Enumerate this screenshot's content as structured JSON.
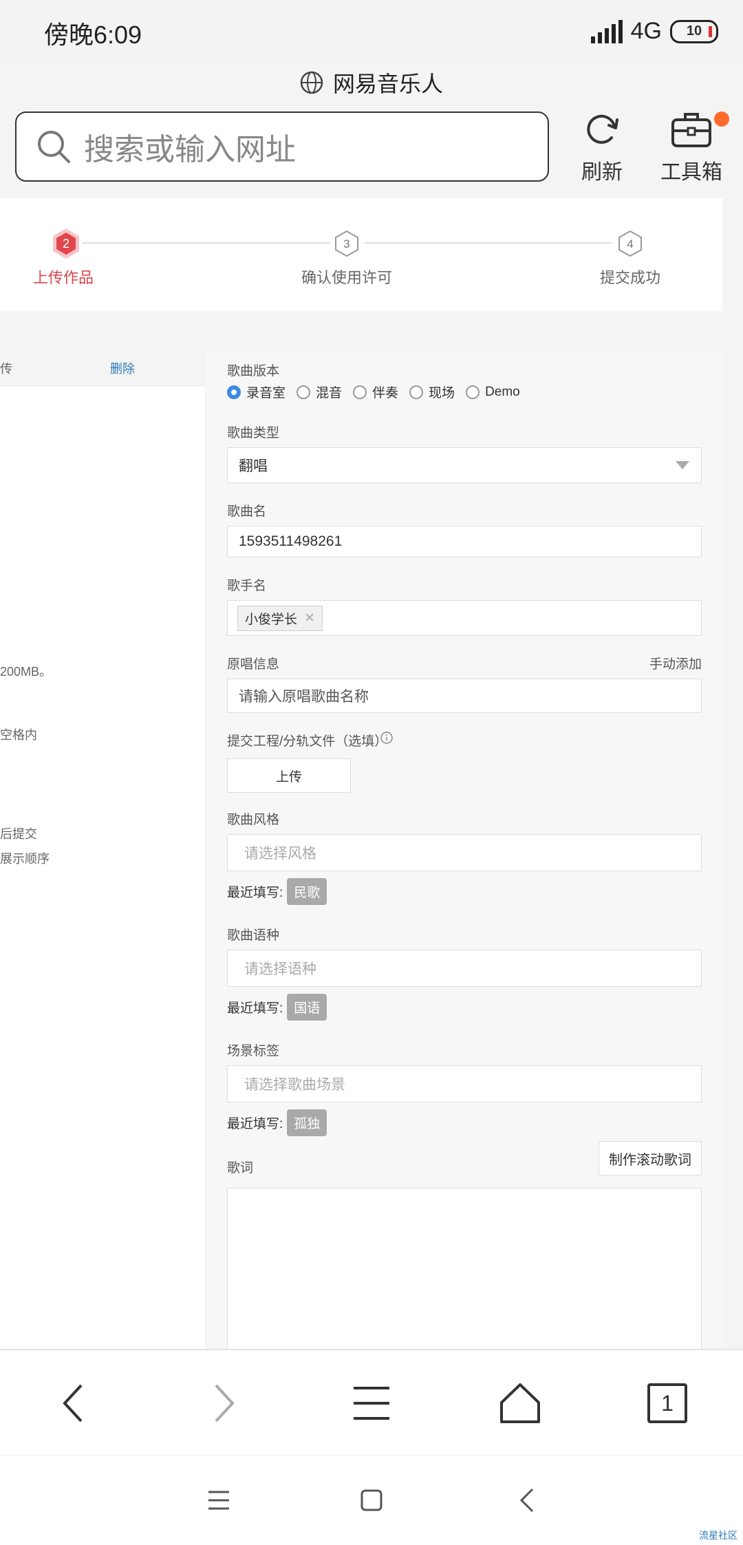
{
  "status_bar": {
    "time": "傍晚6:09",
    "network": "4G",
    "battery": "10"
  },
  "browser": {
    "title": "网易音乐人",
    "search_placeholder": "搜索或输入网址",
    "refresh_label": "刷新",
    "toolbox_label": "工具箱"
  },
  "steps": [
    {
      "number": "2",
      "label": "上传作品",
      "active": true
    },
    {
      "number": "3",
      "label": "确认使用许可",
      "active": false
    },
    {
      "number": "4",
      "label": "提交成功",
      "active": false
    }
  ],
  "left_panel": {
    "header_text": "传",
    "delete_label": "删除",
    "lines": [
      "200MB。",
      "空格内",
      "后提交",
      "展示顺序"
    ]
  },
  "form": {
    "version": {
      "label": "歌曲版本",
      "options": [
        "录音室",
        "混音",
        "伴奏",
        "现场",
        "Demo"
      ],
      "selected": "录音室"
    },
    "song_type": {
      "label": "歌曲类型",
      "value": "翻唱"
    },
    "song_name": {
      "label": "歌曲名",
      "value": "1593511498261"
    },
    "artist": {
      "label": "歌手名",
      "tag": "小俊学长"
    },
    "original": {
      "label": "原唱信息",
      "action": "手动添加",
      "placeholder": "请输入原唱歌曲名称"
    },
    "project_file": {
      "label": "提交工程/分轨文件（选填）",
      "button": "上传"
    },
    "style": {
      "label": "歌曲风格",
      "placeholder": "请选择风格",
      "recent_label": "最近填写:",
      "recent_tag": "民歌"
    },
    "language": {
      "label": "歌曲语种",
      "placeholder": "请选择语种",
      "recent_label": "最近填写:",
      "recent_tag": "国语"
    },
    "scene": {
      "label": "场景标签",
      "placeholder": "请选择歌曲场景",
      "recent_label": "最近填写:",
      "recent_tag": "孤独"
    },
    "lyrics": {
      "label": "歌词",
      "button": "制作滚动歌词"
    }
  },
  "nav": {
    "tab_count": "1"
  },
  "watermark": "流星社区"
}
